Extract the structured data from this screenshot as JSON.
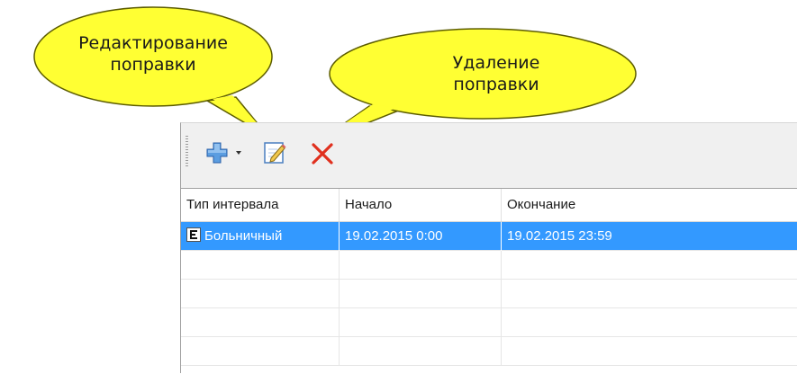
{
  "callouts": {
    "edit": {
      "line1": "Редактирование",
      "line2": "поправки"
    },
    "delete": {
      "line1": "Удаление",
      "line2": "поправки"
    },
    "color": "#ffff33"
  },
  "toolbar": {
    "add_icon": "plus-dropdown-icon",
    "edit_icon": "edit-document-icon",
    "delete_icon": "red-x-icon"
  },
  "grid": {
    "columns": [
      "Тип интервала",
      "Начало",
      "Окончание"
    ],
    "rows": [
      {
        "type_icon": "calendar-e-icon",
        "type": "Больничный",
        "start": "19.02.2015 0:00",
        "end": "19.02.2015 23:59",
        "selected": true
      }
    ],
    "selection_color": "#3399ff"
  }
}
